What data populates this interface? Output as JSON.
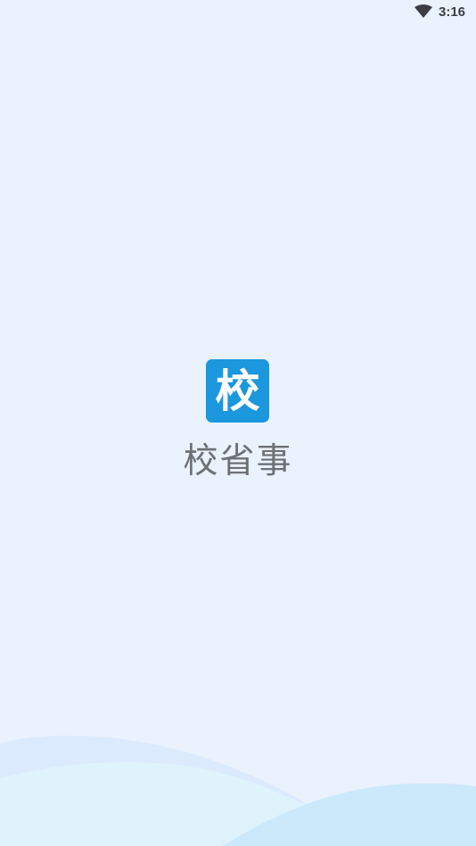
{
  "status_bar": {
    "time": "3:16",
    "wifi_icon": "wifi-icon"
  },
  "splash": {
    "logo_char": "校",
    "app_name": "校省事"
  },
  "colors": {
    "background": "#eaf2fe",
    "logo_bg": "#1b97dd",
    "app_name_text": "#6d7176",
    "wave_light": "#dbeafd",
    "wave_cyan": "#dff3fc",
    "wave_blue": "#cce8fb"
  }
}
